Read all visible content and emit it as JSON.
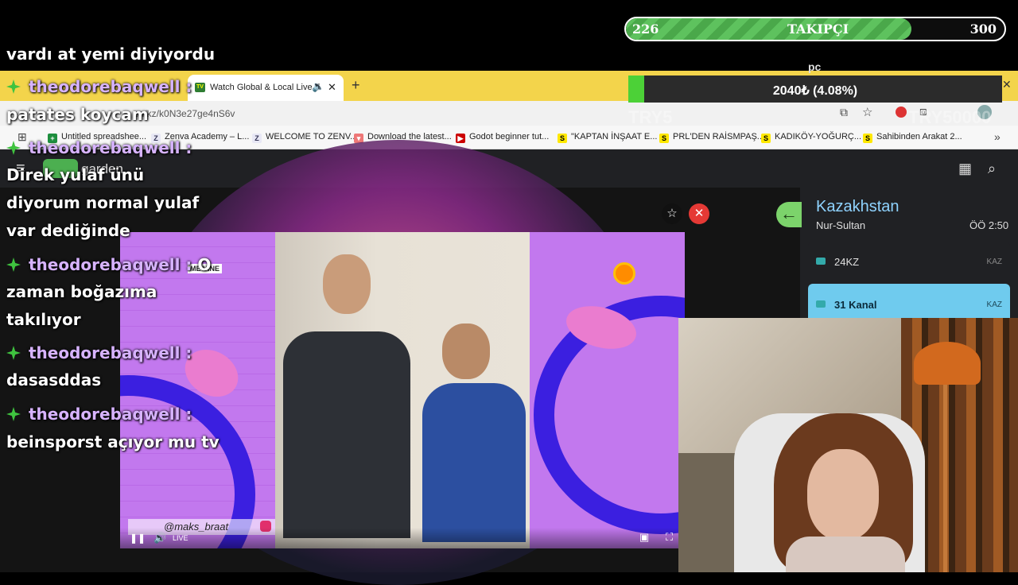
{
  "follower_goal": {
    "current": "226",
    "label": "TAKIPÇI",
    "goal": "300",
    "progress": 0.754
  },
  "donation_bar": {
    "text": "2040₺ (4.08%)",
    "progress": 0.0408,
    "sub_left": "TRY5",
    "sub_right": "TRY50000"
  },
  "pc_label": "pc",
  "browser": {
    "tab_title": "Watch Global & Local Live T",
    "url_partial": "en/kz/k0N3e27ge4nS6v",
    "bookmarks": [
      "Untitled spreadshee...",
      "Zenva Academy – L...",
      "WELCOME TO ZENV...",
      "Download the latest...",
      "Godot beginner tut...",
      "\"KAPTAN İNŞAAT E...",
      "PRL'DEN RAİSMPAŞ...",
      "KADIKÖY-YOĞURÇ...",
      "Sahibinden Arakat 2..."
    ],
    "site_name": "garden"
  },
  "country_panel": {
    "country": "Kazakhstan",
    "city": "Nur-Sultan",
    "time": "ÖÖ 2:50",
    "channels": [
      {
        "name": "24KZ",
        "code": "KAZ",
        "active": false
      },
      {
        "name": "31 Kanal",
        "code": "KAZ",
        "active": true
      }
    ]
  },
  "video": {
    "watermark": "ME VINE",
    "handle": "@maks_braat",
    "live_label": "LIVE"
  },
  "chat": [
    {
      "user": "",
      "text": "vardı at yemi diyiyordu"
    },
    {
      "user": "theodorebaqwell :",
      "text": ""
    },
    {
      "user": "",
      "text": "patates koycam"
    },
    {
      "user": "theodorebaqwell :",
      "text": ""
    },
    {
      "user": "",
      "text": "Direk yulaf ünü"
    },
    {
      "user": "",
      "text": "diyorum normal yulaf"
    },
    {
      "user": "",
      "text": "var dediğinde"
    },
    {
      "user": "theodorebaqwell :",
      "text": "O"
    },
    {
      "user": "",
      "text": "zaman boğazıma"
    },
    {
      "user": "",
      "text": "takılıyor"
    },
    {
      "user": "theodorebaqwell :",
      "text": ""
    },
    {
      "user": "",
      "text": "dasasddas"
    },
    {
      "user": "theodorebaqwell :",
      "text": ""
    },
    {
      "user": "",
      "text": "beinsporst açıyor mu tv"
    }
  ]
}
